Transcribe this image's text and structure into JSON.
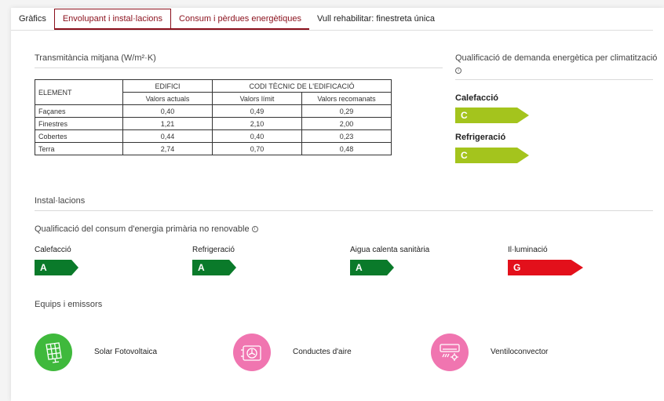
{
  "tabs": [
    {
      "label": "Gràfics"
    },
    {
      "label": "Envolupant i instal·lacions"
    },
    {
      "label": "Consum i pèrdues energètiques"
    },
    {
      "label": "Vull rehabilitar: finestreta única"
    }
  ],
  "transmittance": {
    "title": "Transmitància mitjana (W/m²·K)",
    "headers": {
      "element": "ELEMENT",
      "edifici": "EDIFICI",
      "codi": "CODI TÈCNIC DE L'EDIFICACIÓ",
      "actuals": "Valors actuals",
      "limit": "Valors límit",
      "recomanats": "Valors recomanats"
    },
    "rows": [
      {
        "element": "Façanes",
        "actual": "0,40",
        "limit": "0,49",
        "rec": "0,29"
      },
      {
        "element": "Finestres",
        "actual": "1,21",
        "limit": "2,10",
        "rec": "2,00"
      },
      {
        "element": "Cobertes",
        "actual": "0,44",
        "limit": "0,40",
        "rec": "0,23"
      },
      {
        "element": "Terra",
        "actual": "2,74",
        "limit": "0,70",
        "rec": "0,48"
      }
    ]
  },
  "demand": {
    "title": "Qualificació de demanda energètica per climatització",
    "items": [
      {
        "label": "Calefacció",
        "grade": "C",
        "color": "#a4c41d"
      },
      {
        "label": "Refrigeració",
        "grade": "C",
        "color": "#a4c41d"
      }
    ]
  },
  "installations": {
    "title": "Instal·lacions",
    "consum_title": "Qualificació del consum d'energia primària no renovable",
    "items": [
      {
        "label": "Calefacció",
        "grade": "A",
        "color": "#0a7a2a"
      },
      {
        "label": "Refrigeració",
        "grade": "A",
        "color": "#0a7a2a"
      },
      {
        "label": "Aigua calenta sanitària",
        "grade": "A",
        "color": "#0a7a2a"
      },
      {
        "label": "Il·luminació",
        "grade": "G",
        "color": "#e3101b"
      }
    ]
  },
  "equips": {
    "title": "Equips i emissors",
    "items": [
      {
        "label": "Solar Fotovoltaica",
        "icon": "solar-panel-icon",
        "color": "#3fb93c"
      },
      {
        "label": "Conductes d'aire",
        "icon": "air-duct-icon",
        "color": "#f075b0"
      },
      {
        "label": "Ventiloconvector",
        "icon": "fan-coil-icon",
        "color": "#f075b0"
      }
    ]
  }
}
